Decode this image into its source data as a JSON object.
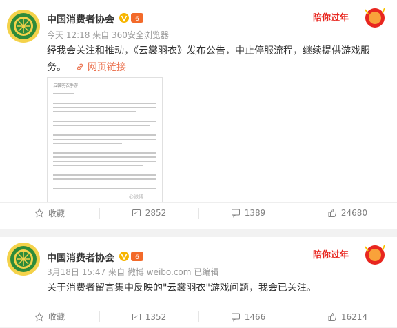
{
  "posts": [
    {
      "author": "中国消费者协会",
      "meta": "今天 12:18 来自 360安全浏览器",
      "text": "经我会关注和推动，《云裳羽衣》发布公告，中止停服流程，继续提供游戏服务。",
      "link_icon": "link-icon",
      "link_label": "网页链接",
      "badge_text": "陪你过年",
      "doc_header": "云裳羽衣手游",
      "doc_watermark": "@微博",
      "actions": {
        "favorite": "收藏",
        "repost": "2852",
        "comment": "1389",
        "like": "24680"
      }
    },
    {
      "author": "中国消费者协会",
      "meta": "3月18日 15:47 来自 微博 weibo.com  已编辑",
      "text": "关于消费者留言集中反映的\"云裳羽衣\"游戏问题，我会已关注。",
      "badge_text": "陪你过年",
      "actions": {
        "favorite": "收藏",
        "repost": "1352",
        "comment": "1466",
        "like": "16214"
      }
    }
  ],
  "colors": {
    "link": "#eb7350",
    "verified": "#f7b500",
    "badge_red": "#e8261f"
  }
}
